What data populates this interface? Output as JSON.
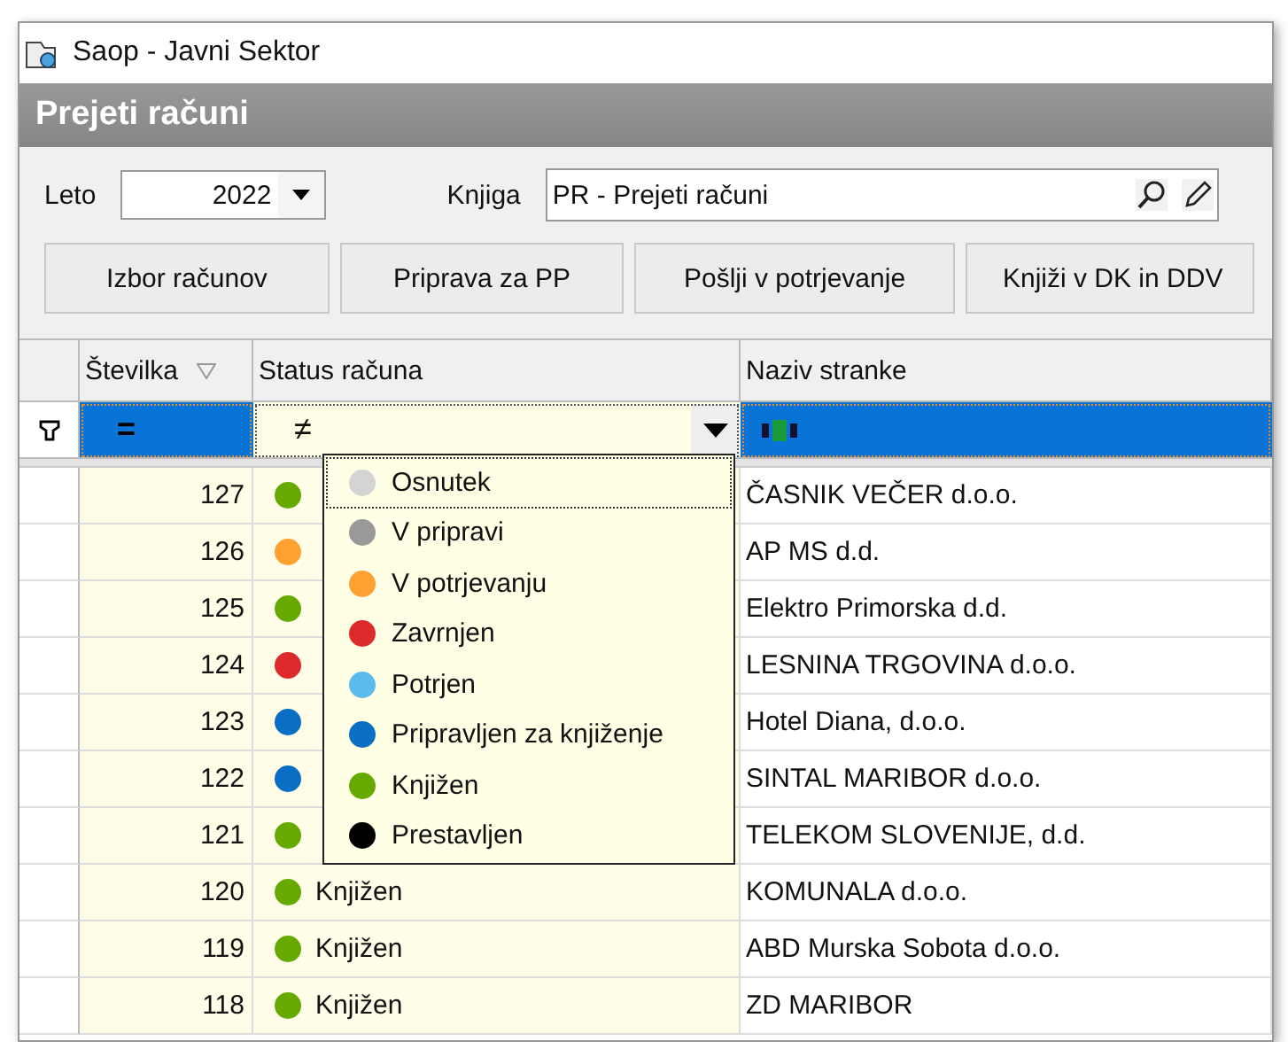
{
  "window": {
    "title": "Saop  - Javni Sektor"
  },
  "panel": {
    "title": "Prejeti računi"
  },
  "fields": [
    {
      "label": "Leto",
      "value": "2022",
      "kind": "combo"
    },
    {
      "label": "Knjiga",
      "value": "PR - Prejeti računi",
      "kind": "lookup"
    }
  ],
  "buttons": [
    "Izbor računov",
    "Priprava za PP",
    "Pošlji v potrjevanje",
    "Knjiži v DK in DDV"
  ],
  "table": {
    "columns": [
      {
        "label": "Številka",
        "sort_indicator": true
      },
      {
        "label": "Status računa",
        "sort_indicator": false
      },
      {
        "label": "Naziv stranke",
        "sort_indicator": false
      }
    ],
    "filter_row": [
      {
        "kind": "operator",
        "operator": "=",
        "selected": true,
        "expanded": false
      },
      {
        "kind": "operator",
        "operator": "≠",
        "selected": false,
        "expanded": true
      },
      {
        "kind": "text-match",
        "selected": true,
        "expanded": false
      }
    ],
    "status_options": [
      {
        "label": "Osnutek",
        "color": "#d4d4d4",
        "focused": true
      },
      {
        "label": "V pripravi",
        "color": "#999999",
        "focused": false
      },
      {
        "label": "V potrjevanju",
        "color": "#ffa033",
        "focused": false
      },
      {
        "label": "Zavrnjen",
        "color": "#dd2a2a",
        "focused": false
      },
      {
        "label": "Potrjen",
        "color": "#5bbbec",
        "focused": false
      },
      {
        "label": "Pripravljen za knjiženje",
        "color": "#0a6fc2",
        "focused": false
      },
      {
        "label": "Knjižen",
        "color": "#66aa00",
        "focused": false
      },
      {
        "label": "Prestavljen",
        "color": "#000000",
        "focused": false
      }
    ],
    "rows": [
      {
        "number": "127",
        "color": "#66aa00",
        "customer": "ČASNIK VEČER d.o.o."
      },
      {
        "number": "126",
        "color": "#ffa033",
        "customer": "AP MS d.d."
      },
      {
        "number": "125",
        "color": "#66aa00",
        "customer": "Elektro Primorska d.d."
      },
      {
        "number": "124",
        "color": "#dd2a2a",
        "customer": "LESNINA TRGOVINA d.o.o."
      },
      {
        "number": "123",
        "color": "#0a6fc2",
        "customer": "Hotel Diana, d.o.o."
      },
      {
        "number": "122",
        "color": "#0a6fc2",
        "customer": "SINTAL MARIBOR d.o.o."
      },
      {
        "number": "121",
        "color": "#66aa00",
        "customer": "TELEKOM SLOVENIJE, d.d."
      },
      {
        "number": "120",
        "color": "#66aa00",
        "status": "Knjižen",
        "customer": "KOMUNALA d.o.o."
      },
      {
        "number": "119",
        "color": "#66aa00",
        "status": "Knjižen",
        "customer": "ABD Murska Sobota d.o.o."
      },
      {
        "number": "118",
        "color": "#66aa00",
        "status": "Knjižen",
        "customer": "ZD MARIBOR"
      }
    ]
  }
}
